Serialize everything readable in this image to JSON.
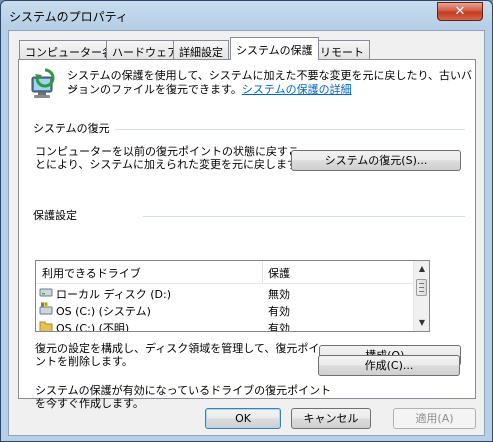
{
  "window": {
    "title": "システムのプロパティ",
    "close_label": "✕"
  },
  "tabs": [
    {
      "label": "コンピューター名"
    },
    {
      "label": "ハードウェア"
    },
    {
      "label": "詳細設定"
    },
    {
      "label": "システムの保護"
    },
    {
      "label": "リモート"
    }
  ],
  "intro": {
    "line1": "システムの保護を使用して、システムに加えた不要な変更を元に戻したり、古いバー",
    "line2": "ジョンのファイルを復元できます。",
    "link": "システムの保護の詳細"
  },
  "restore": {
    "heading": "システムの復元",
    "desc1": "コンピューターを以前の復元ポイントの状態に戻すこ",
    "desc2": "とにより、システムに加えられた変更を元に戻します。",
    "button": "システムの復元(S)..."
  },
  "protection": {
    "heading": "保護設定",
    "columns": {
      "drive": "利用できるドライブ",
      "status": "保護"
    },
    "rows": [
      {
        "drive": "ローカル ディスク (D:)",
        "status": "無効",
        "icon": "local-disk-icon"
      },
      {
        "drive": "OS (C:) (システム)",
        "status": "有効",
        "icon": "system-drive-icon"
      },
      {
        "drive": "OS (C:) (不明)",
        "status": "有効",
        "icon": "folder-drive-icon"
      }
    ],
    "configure_desc1": "復元の設定を構成し、ディスク領域を管理して、復元ポイ",
    "configure_desc2": "ントを削除します。",
    "configure_button": "構成(O)...",
    "create_desc1": "システムの保護が有効になっているドライブの復元ポイント",
    "create_desc2": "を今すぐ作成します。",
    "create_button": "作成(C)..."
  },
  "footer": {
    "ok": "OK",
    "cancel": "キャンセル",
    "apply": "適用(A)"
  }
}
